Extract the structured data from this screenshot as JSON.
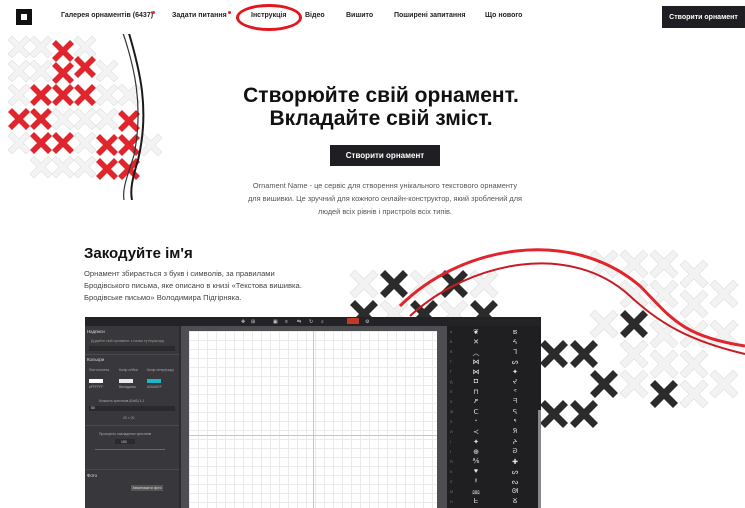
{
  "nav": {
    "items": [
      {
        "label": "Галерея орнаментів (6437)",
        "dot": true
      },
      {
        "label": "Задати питання",
        "dot": true
      },
      {
        "label": "Інструкція",
        "dot": false,
        "highlighted": true
      },
      {
        "label": "Відео",
        "dot": false
      },
      {
        "label": "Вишито",
        "dot": false
      },
      {
        "label": "Поширені запитання",
        "dot": false
      },
      {
        "label": "Що нового",
        "dot": false
      }
    ],
    "cta_label": "Створити орнамент"
  },
  "hero": {
    "title_line1": "Створюйте свій орнамент.",
    "title_line2": "Вкладайте свій зміст.",
    "button_label": "Створити орнамент",
    "description": "Ornament Name - це сервіс для створення унікального текстового орнаменту для вишивки. Це зручний для кожного онлайн-конструктор, який зроблений для людей всіх рівнів і пристроїв всіх типів."
  },
  "section": {
    "title": "Закодуйте ім'я",
    "description": "Орнамент збирається з букв і символів, за правилами Бродівського письма, яке описано в книзі «Текстова вишивка. Бродівське письмо» Володимира Підгірняка."
  },
  "colors": {
    "accent_red": "#e3161d",
    "dark_button": "#1e1e23",
    "cross_red": "#e0252c",
    "cross_dark": "#2b2b2b"
  },
  "app": {
    "left_panel": {
      "section1_title": "Надписи",
      "section1_hint": "Додайте свій орнамент з назви тут/приклад",
      "section2_title": "Кольори",
      "color_labels": [
        "Фон полотна",
        "Колір стібка",
        "Колір літер/узору"
      ],
      "color_values": [
        "#FFFFFF",
        "Випадково",
        "#00ADEF"
      ],
      "color_swatches": [
        "#ffffff",
        "#e8e8e8",
        "#1fb6c6"
      ],
      "size_label": "Кількість хрестиків (ШхВ) 1:1",
      "size_value": "50",
      "size_display": "20 × 20",
      "hint2": "Прозорість накладених хрестиків",
      "opacity_value": "100",
      "section3_title": "Фото",
      "photo_button": "Завантажити фото"
    },
    "glyphs_left": [
      "❦",
      "✕",
      "︿",
      "⋈",
      "⋈",
      "◘",
      "⊓",
      "ዖ",
      "ᑕ",
      "ᐩ",
      "≺",
      "✦",
      "⊕",
      "⅍",
      "♥",
      "☿",
      "⅏",
      "ᖶ"
    ],
    "glyphs_right": [
      "ຣ",
      "ᔦ",
      "ᒣ",
      "ᔕ",
      "✦",
      "ᔪ",
      "ᕝ",
      "ᖷ",
      "ᕋ",
      "ᕐ",
      "ᖆ",
      "ᔨ",
      "ᘐ",
      "✚",
      "ᔕ",
      "ᔓ",
      "ᘛ",
      "ᘜ"
    ],
    "row_numbers": [
      "A",
      "Б",
      "В",
      "Г",
      "Ґ",
      "Д",
      "Е",
      "Є",
      "Ж",
      "З",
      "И",
      "І",
      "Ї",
      "Й",
      "К",
      "Л",
      "М",
      "Н"
    ]
  }
}
